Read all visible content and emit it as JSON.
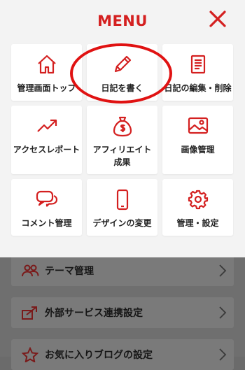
{
  "menu": {
    "title": "MENU",
    "items": [
      {
        "label": "管理画面トップ",
        "icon": "home-icon"
      },
      {
        "label": "日記を書く",
        "icon": "pencil-icon"
      },
      {
        "label": "日記の編集・削除",
        "icon": "document-icon"
      },
      {
        "label": "アクセスレポート",
        "icon": "trending-up-icon"
      },
      {
        "label": "アフィリエイト成果",
        "icon": "money-bag-icon"
      },
      {
        "label": "画像管理",
        "icon": "image-icon"
      },
      {
        "label": "コメント管理",
        "icon": "comment-icon"
      },
      {
        "label": "デザインの変更",
        "icon": "smartphone-icon"
      },
      {
        "label": "管理・設定",
        "icon": "gear-icon"
      }
    ]
  },
  "background_list": {
    "items": [
      {
        "label": "テーマ管理",
        "icon": "people-icon"
      },
      {
        "label": "外部サービス連携設定",
        "icon": "share-icon"
      },
      {
        "label": "お気に入りブログの設定",
        "icon": "star-icon"
      }
    ]
  },
  "colors": {
    "accent": "#d42020",
    "menu_bg": "#f3f3f3",
    "tile_bg": "#ffffff",
    "overlay_bg": "#6f6f6f"
  }
}
